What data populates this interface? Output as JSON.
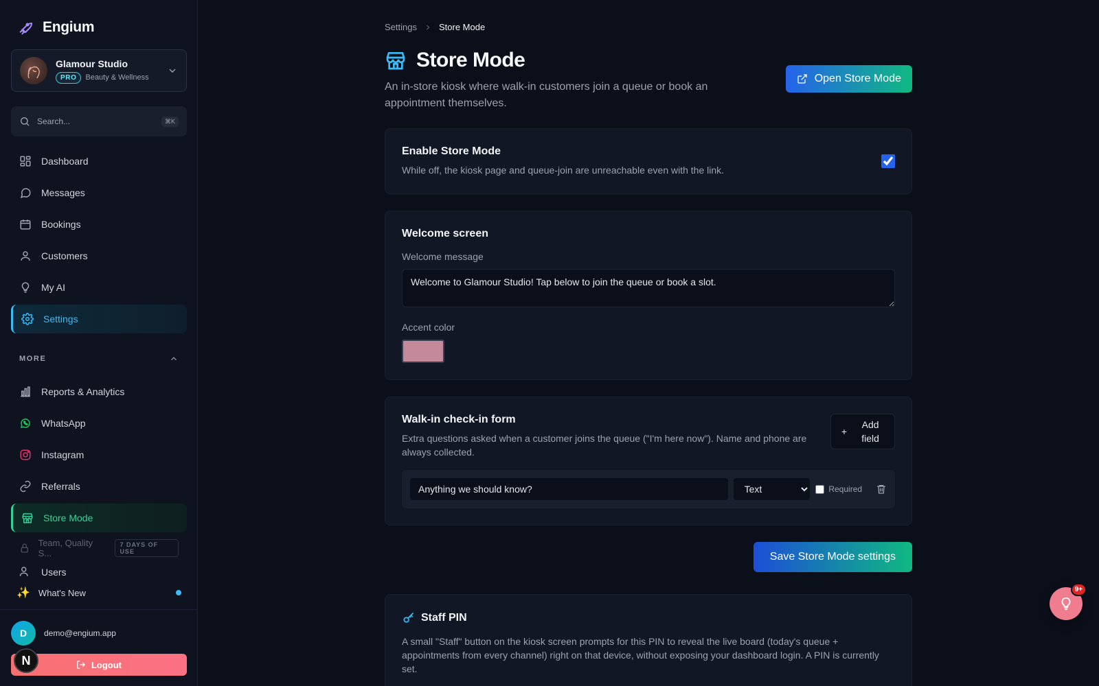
{
  "brand": {
    "name": "Engium"
  },
  "workspace": {
    "name": "Glamour Studio",
    "badge": "PRO",
    "category": "Beauty & Wellness"
  },
  "search": {
    "placeholder": "Search...",
    "shortcut": "⌘K"
  },
  "nav": {
    "main": [
      {
        "label": "Dashboard",
        "icon": "grid-icon"
      },
      {
        "label": "Messages",
        "icon": "chat-icon"
      },
      {
        "label": "Bookings",
        "icon": "calendar-icon"
      },
      {
        "label": "Customers",
        "icon": "users-icon"
      },
      {
        "label": "My AI",
        "icon": "bulb-icon"
      },
      {
        "label": "Settings",
        "icon": "gear-icon",
        "active": true
      }
    ],
    "more_title": "MORE",
    "more": [
      {
        "label": "Reports & Analytics",
        "icon": "bar-chart-icon"
      },
      {
        "label": "WhatsApp",
        "icon": "whatsapp-icon"
      },
      {
        "label": "Instagram",
        "icon": "instagram-icon"
      },
      {
        "label": "Referrals",
        "icon": "link-icon"
      },
      {
        "label": "Store Mode",
        "icon": "store-icon",
        "active": true
      }
    ],
    "locked": {
      "label": "Team, Quality S...",
      "badge": "7 DAYS OF USE"
    },
    "cut_item": {
      "label": "Users"
    }
  },
  "whats_new": {
    "label": "What's New"
  },
  "user": {
    "initial": "D",
    "email": "demo@engium.app",
    "logout": "Logout",
    "n_badge": "N"
  },
  "breadcrumb": {
    "parent": "Settings",
    "current": "Store Mode"
  },
  "page": {
    "title": "Store Mode",
    "description": "An in-store kiosk where walk-in customers join a queue or book an appointment themselves.",
    "open_button": "Open Store Mode"
  },
  "enable": {
    "title": "Enable Store Mode",
    "description": "While off, the kiosk page and queue-join are unreachable even with the link.",
    "checked": true
  },
  "welcome": {
    "title": "Welcome screen",
    "message_label": "Welcome message",
    "message_value": "Welcome to Glamour Studio! Tap below to join the queue or book a slot.",
    "accent_label": "Accent color",
    "accent_color": "#c48a9c"
  },
  "walkin": {
    "title": "Walk-in check-in form",
    "description": "Extra questions asked when a customer joins the queue (\"I'm here now\"). Name and phone are always collected.",
    "add_field_label": "Add field",
    "fields": [
      {
        "question": "Anything we should know?",
        "type": "Text",
        "required_label": "Required",
        "required": false
      }
    ]
  },
  "save_button": "Save Store Mode settings",
  "staff_pin": {
    "title": "Staff PIN",
    "description": "A small \"Staff\" button on the kiosk screen prompts for this PIN to reveal the live board (today's queue + appointments from every channel) right on that device, without exposing your dashboard login. A PIN is currently set."
  },
  "fab": {
    "badge": "9+"
  },
  "colors": {
    "accent_blue": "#38bdf8",
    "accent_green": "#34d399",
    "logout": "#f87171"
  }
}
